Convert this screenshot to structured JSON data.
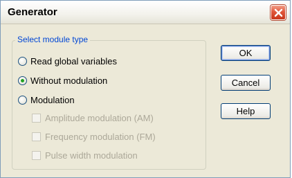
{
  "window": {
    "title": "Generator",
    "close_icon": "close-icon"
  },
  "group": {
    "legend": "Select module type",
    "radios": [
      {
        "label": "Read global variables",
        "selected": false
      },
      {
        "label": "Without modulation",
        "selected": true
      },
      {
        "label": "Modulation",
        "selected": false
      }
    ],
    "checkboxes": [
      {
        "label": "Amplitude modulation (AM)",
        "checked": false,
        "enabled": false
      },
      {
        "label": "Frequency modulation (FM)",
        "checked": false,
        "enabled": false
      },
      {
        "label": "Pulse width modulation",
        "checked": false,
        "enabled": false
      }
    ]
  },
  "buttons": {
    "ok": "OK",
    "cancel": "Cancel",
    "help": "Help"
  },
  "colors": {
    "legend": "#0046d5",
    "radio_dot": "#21a121",
    "disabled_text": "#aca899",
    "face": "#ece9d8"
  }
}
